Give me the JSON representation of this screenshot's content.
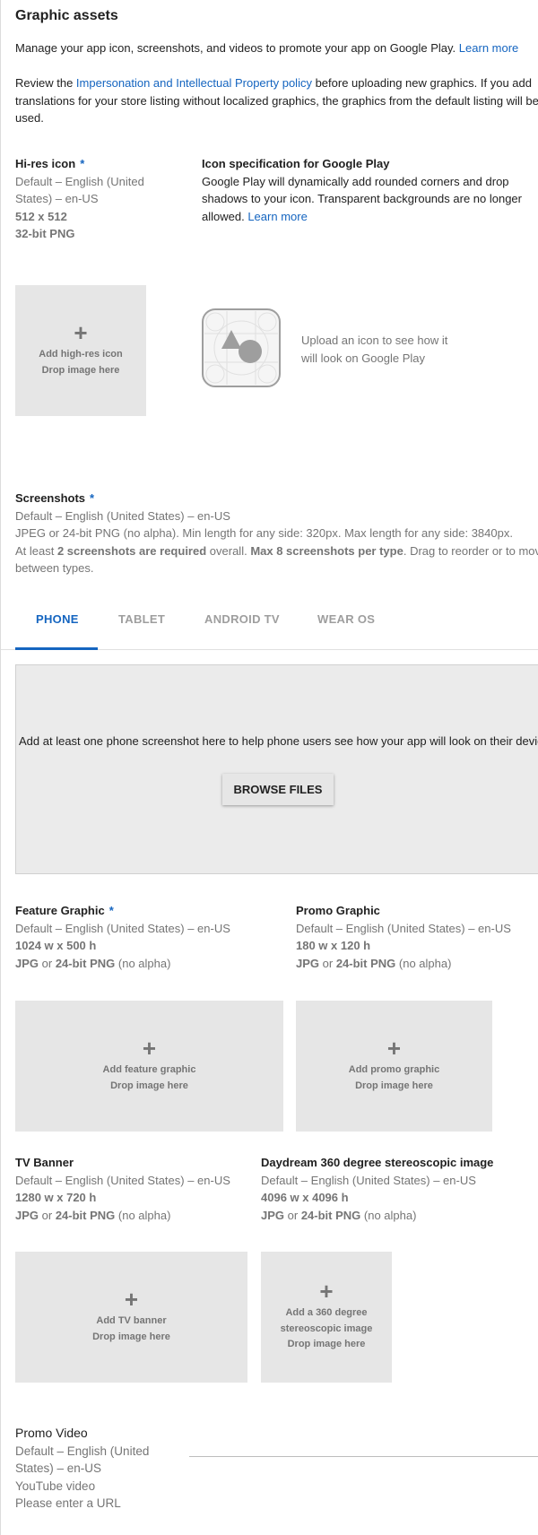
{
  "page": {
    "title": "Graphic assets",
    "intro": "Manage your app icon, screenshots, and videos to promote your app on Google Play.",
    "intro_link": "Learn more",
    "review_prefix": "Review the ",
    "review_link": "Impersonation and Intellectual Property policy",
    "review_line1_suffix": " before uploading new graphics. If you add",
    "review_line2": "translations for your store listing without localized graphics, the graphics from the default listing will be",
    "review_line3": "used."
  },
  "hires_icon": {
    "label": "Hi-res icon",
    "required": "*",
    "locale_line1": "Default – English (United",
    "locale_line2": "States) – en-US",
    "size": "512 x 512",
    "format": "32-bit PNG",
    "drop_label": "Add high-res icon",
    "drop_hint": "Drop image here"
  },
  "icon_spec": {
    "title": "Icon specification for Google Play",
    "line1": "Google Play will dynamically add rounded corners and drop",
    "line2": "shadows to your icon. Transparent backgrounds are no longer",
    "line3": "allowed.",
    "link": "Learn more",
    "preview_line1": "Upload an icon to see how it",
    "preview_line2": "will look on Google Play"
  },
  "screenshots": {
    "label": "Screenshots",
    "required": "*",
    "locale": "Default – English (United States) – en-US",
    "format": "JPEG or 24-bit PNG (no alpha). Min length for any side: 320px. Max length for any side: 3840px.",
    "rule_a": "At least ",
    "rule_b": "2 screenshots are required",
    "rule_c": " overall. ",
    "rule_d": "Max 8 screenshots per type",
    "rule_e": ". Drag to reorder or to move",
    "rule_line2": "between types.",
    "tabs": [
      "PHONE",
      "TABLET",
      "ANDROID TV",
      "WEAR OS"
    ],
    "drop_text": "Add at least one phone screenshot here to help phone users see how your app will look on their device.",
    "browse_button": "BROWSE FILES"
  },
  "feature_graphic": {
    "label": "Feature Graphic",
    "required": "*",
    "locale": "Default – English (United States) – en-US",
    "size": "1024 w x 500 h",
    "fmt_a": "JPG",
    "fmt_or": " or ",
    "fmt_b": "24-bit PNG",
    "fmt_c": " (no alpha)",
    "drop_label": "Add feature graphic",
    "drop_hint": "Drop image here"
  },
  "promo_graphic": {
    "label": "Promo Graphic",
    "locale": "Default – English (United States) – en-US",
    "size": "180 w x 120 h",
    "fmt_a": "JPG",
    "fmt_or": " or ",
    "fmt_b": "24-bit PNG",
    "fmt_c": " (no alpha)",
    "drop_label": "Add promo graphic",
    "drop_hint": "Drop image here"
  },
  "tv_banner": {
    "label": "TV Banner",
    "locale": "Default – English (United States) – en-US",
    "size": "1280 w x 720 h",
    "fmt_a": "JPG",
    "fmt_or": " or ",
    "fmt_b": "24-bit PNG",
    "fmt_c": " (no alpha)",
    "drop_label": "Add TV banner",
    "drop_hint": "Drop image here"
  },
  "daydream": {
    "label": "Daydream 360 degree stereoscopic image",
    "locale": "Default – English (United States) – en-US",
    "size": "4096 w x 4096 h",
    "fmt_a": "JPG",
    "fmt_or": " or ",
    "fmt_b": "24-bit PNG",
    "fmt_c": " (no alpha)",
    "drop_line1": "Add a 360 degree",
    "drop_line2": "stereoscopic image",
    "drop_hint": "Drop image here"
  },
  "promo_video": {
    "label": "Promo Video",
    "locale_line1": "Default – English (United",
    "locale_line2": "States) – en-US",
    "type": "YouTube video",
    "hint": "Please enter a URL"
  },
  "colors": {
    "accent": "#1565c0",
    "drop_bg": "#e6e6e6",
    "secondary_text": "#757575"
  }
}
